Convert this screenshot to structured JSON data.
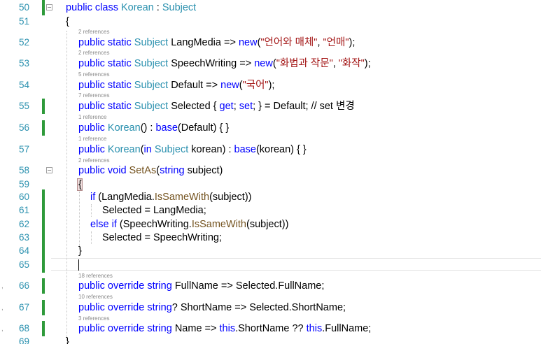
{
  "editor": {
    "lines": [
      {
        "num": "50",
        "lens": "",
        "tokens": [
          {
            "t": "public class ",
            "c": "kw"
          },
          {
            "t": "Korean",
            "c": "ty"
          },
          {
            "t": " : ",
            "c": ""
          },
          {
            "t": "Subject",
            "c": "ty"
          }
        ]
      },
      {
        "num": "51",
        "lens": "",
        "tokens": [
          {
            "t": "{",
            "c": ""
          }
        ]
      },
      {
        "num": "52",
        "lens": "2 references",
        "tokens": [
          {
            "t": "public static ",
            "c": "kw"
          },
          {
            "t": "Subject",
            "c": "ty"
          },
          {
            "t": " LangMedia => ",
            "c": ""
          },
          {
            "t": "new",
            "c": "kw"
          },
          {
            "t": "(",
            "c": ""
          },
          {
            "t": "\"언어와 매체\"",
            "c": "st"
          },
          {
            "t": ", ",
            "c": ""
          },
          {
            "t": "\"언매\"",
            "c": "st"
          },
          {
            "t": ");",
            "c": ""
          }
        ]
      },
      {
        "num": "53",
        "lens": "2 references",
        "tokens": [
          {
            "t": "public static ",
            "c": "kw"
          },
          {
            "t": "Subject",
            "c": "ty"
          },
          {
            "t": " SpeechWriting => ",
            "c": ""
          },
          {
            "t": "new",
            "c": "kw"
          },
          {
            "t": "(",
            "c": ""
          },
          {
            "t": "\"화법과 작문\"",
            "c": "st"
          },
          {
            "t": ", ",
            "c": ""
          },
          {
            "t": "\"화작\"",
            "c": "st"
          },
          {
            "t": ");",
            "c": ""
          }
        ]
      },
      {
        "num": "54",
        "lens": "5 references",
        "tokens": [
          {
            "t": "public static ",
            "c": "kw"
          },
          {
            "t": "Subject",
            "c": "ty"
          },
          {
            "t": " Default => ",
            "c": ""
          },
          {
            "t": "new",
            "c": "kw"
          },
          {
            "t": "(",
            "c": ""
          },
          {
            "t": "\"국어\"",
            "c": "st"
          },
          {
            "t": ");",
            "c": ""
          }
        ]
      },
      {
        "num": "55",
        "lens": "7 references",
        "tokens": [
          {
            "t": "public static ",
            "c": "kw"
          },
          {
            "t": "Subject",
            "c": "ty"
          },
          {
            "t": " Selected { ",
            "c": ""
          },
          {
            "t": "get",
            "c": "kw"
          },
          {
            "t": "; ",
            "c": ""
          },
          {
            "t": "set",
            "c": "kw"
          },
          {
            "t": "; } = Default; // set 변경",
            "c": ""
          }
        ]
      },
      {
        "num": "56",
        "lens": "1 reference",
        "tokens": [
          {
            "t": "public ",
            "c": "kw"
          },
          {
            "t": "Korean",
            "c": "ty"
          },
          {
            "t": "() : ",
            "c": ""
          },
          {
            "t": "base",
            "c": "kw"
          },
          {
            "t": "(Default) { }",
            "c": ""
          }
        ]
      },
      {
        "num": "57",
        "lens": "1 reference",
        "tokens": [
          {
            "t": "public ",
            "c": "kw"
          },
          {
            "t": "Korean",
            "c": "ty"
          },
          {
            "t": "(",
            "c": ""
          },
          {
            "t": "in ",
            "c": "kw"
          },
          {
            "t": "Subject",
            "c": "ty"
          },
          {
            "t": " korean) : ",
            "c": ""
          },
          {
            "t": "base",
            "c": "kw"
          },
          {
            "t": "(korean) { }",
            "c": ""
          }
        ]
      },
      {
        "num": "58",
        "lens": "2 references",
        "tokens": [
          {
            "t": "public void ",
            "c": "kw"
          },
          {
            "t": "SetAs",
            "c": "fn"
          },
          {
            "t": "(",
            "c": ""
          },
          {
            "t": "string",
            "c": "kw"
          },
          {
            "t": " subject)",
            "c": ""
          }
        ]
      },
      {
        "num": "59",
        "lens": "",
        "tokens": [
          {
            "t": "{",
            "c": ""
          }
        ]
      },
      {
        "num": "60",
        "lens": "",
        "tokens": [
          {
            "t": "if",
            "c": "kw"
          },
          {
            "t": " (LangMedia.",
            "c": ""
          },
          {
            "t": "IsSameWith",
            "c": "fn"
          },
          {
            "t": "(subject))",
            "c": ""
          }
        ]
      },
      {
        "num": "61",
        "lens": "",
        "tokens": [
          {
            "t": "Selected = LangMedia;",
            "c": ""
          }
        ]
      },
      {
        "num": "62",
        "lens": "",
        "tokens": [
          {
            "t": "else if",
            "c": "kw"
          },
          {
            "t": " (SpeechWriting.",
            "c": ""
          },
          {
            "t": "IsSameWith",
            "c": "fn"
          },
          {
            "t": "(subject))",
            "c": ""
          }
        ]
      },
      {
        "num": "63",
        "lens": "",
        "tokens": [
          {
            "t": "Selected = SpeechWriting;",
            "c": ""
          }
        ]
      },
      {
        "num": "64",
        "lens": "",
        "tokens": [
          {
            "t": "}",
            "c": ""
          }
        ]
      },
      {
        "num": "65",
        "lens": "",
        "tokens": []
      },
      {
        "num": "66",
        "lens": "18 references",
        "tokens": [
          {
            "t": "public override string ",
            "c": "kw"
          },
          {
            "t": "FullName => Selected.FullName;",
            "c": ""
          }
        ]
      },
      {
        "num": "67",
        "lens": "10 references",
        "tokens": [
          {
            "t": "public override string",
            "c": "kw"
          },
          {
            "t": "? ShortName => Selected.ShortName;",
            "c": ""
          }
        ]
      },
      {
        "num": "68",
        "lens": "3 references",
        "tokens": [
          {
            "t": "public override string ",
            "c": "kw"
          },
          {
            "t": "Name => ",
            "c": ""
          },
          {
            "t": "this",
            "c": "kw"
          },
          {
            "t": ".ShortName ?? ",
            "c": ""
          },
          {
            "t": "this",
            "c": "kw"
          },
          {
            "t": ".FullName;",
            "c": ""
          }
        ]
      },
      {
        "num": "69",
        "lens": "",
        "tokens": [
          {
            "t": "}",
            "c": ""
          }
        ]
      }
    ]
  },
  "colors": {
    "keyword": "#0000ff",
    "type": "#2b91af",
    "string": "#a31515",
    "method": "#74531f",
    "line_number": "#2b91af",
    "change_bar": "#2e9a3a",
    "codelens": "#8a8a8a"
  }
}
